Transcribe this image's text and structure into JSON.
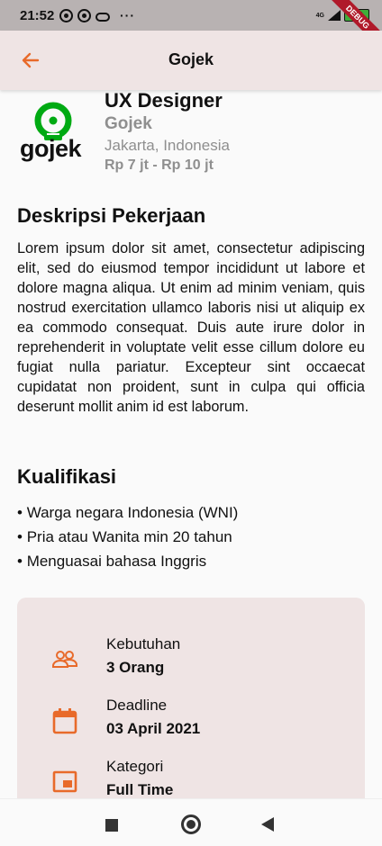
{
  "status_bar": {
    "time": "21:52",
    "more": "···",
    "battery": "100",
    "network": "4G",
    "debug_banner": "DEBUG"
  },
  "app_bar": {
    "title": "Gojek",
    "back_icon": "arrow-left-icon"
  },
  "job": {
    "logo_text": "gojek",
    "title": "UX Designer",
    "company": "Gojek",
    "location": "Jakarta, Indonesia",
    "salary": "Rp 7 jt - Rp 10 jt"
  },
  "description": {
    "heading": "Deskripsi Pekerjaan",
    "body": "Lorem ipsum dolor sit amet, consectetur adipiscing elit, sed do eiusmod tempor incididunt ut labore et dolore magna aliqua. Ut enim ad minim veniam, quis nostrud exercitation ullamco laboris nisi ut aliquip ex ea commodo consequat. Duis aute irure dolor in reprehenderit in voluptate velit esse cillum dolore eu fugiat nulla pariatur. Excepteur sint occaecat cupidatat non proident, sunt in culpa qui officia deserunt mollit anim id est laborum."
  },
  "qualifications": {
    "heading": "Kualifikasi",
    "items": [
      "Warga negara Indonesia (WNI)",
      "Pria atau Wanita min 20 tahun",
      "Menguasai bahasa Inggris"
    ]
  },
  "info": [
    {
      "icon": "people-icon",
      "label": "Kebutuhan",
      "value": "3 Orang"
    },
    {
      "icon": "calendar-icon",
      "label": "Deadline",
      "value": "03 April 2021"
    },
    {
      "icon": "category-icon",
      "label": "Kategori",
      "value": "Full Time"
    }
  ],
  "colors": {
    "accent": "#e86a2a",
    "appbar_bg": "#efe4e4",
    "gojek_green": "#00aa13",
    "muted_text": "#8f8f8f"
  }
}
